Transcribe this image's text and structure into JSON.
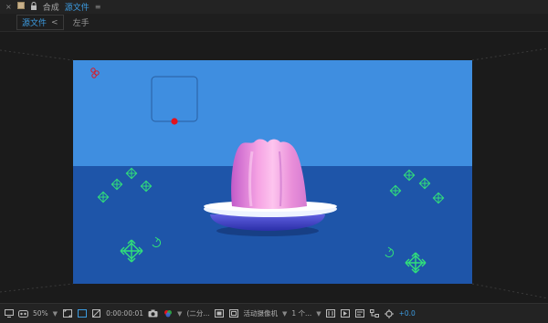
{
  "tab_bar": {
    "close_glyph": "×",
    "title_prefix": "合成",
    "title_active": "源文件",
    "menu_glyph": "≡"
  },
  "breadcrumb": {
    "active": "源文件",
    "separator": "<",
    "next": "左手"
  },
  "status_bar": {
    "zoom": "50%",
    "timecode": "0:00:00:01",
    "resolution": "(二分...",
    "camera": "活动摄像机",
    "views": "1 个...",
    "exposure": "+0.0"
  },
  "scene": {
    "sky_color": "#3f8ee0",
    "floor_color": "#1e55a9",
    "accent_color": "#3c9be0",
    "null_color": "#31e07a",
    "point_color": "#e3131c"
  }
}
